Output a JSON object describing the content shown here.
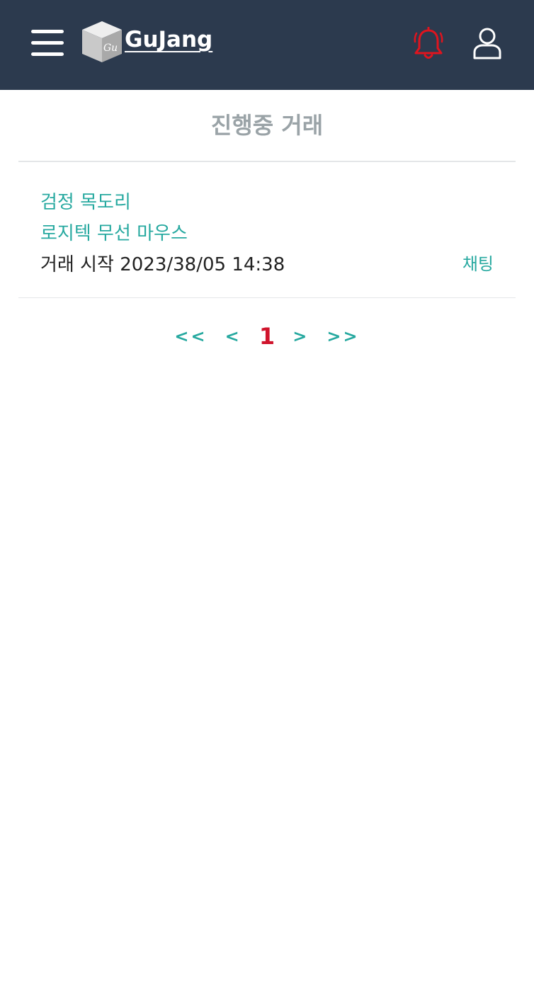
{
  "header": {
    "logo_text": "GuJang",
    "logo_cube_text": "Gu",
    "bell_color": "#e0141e"
  },
  "page": {
    "title": "진행중 거래"
  },
  "trades": [
    {
      "item_names": [
        "검정 목도리",
        "로지텍 무선 마우스"
      ],
      "start_label": "거래 시작 2023/38/05 14:38",
      "chat_label": "채팅"
    }
  ],
  "pagination": {
    "first": "<<",
    "prev": "<",
    "current": "1",
    "next": ">",
    "last": ">>"
  },
  "colors": {
    "header_bg": "#2c3a4e",
    "accent": "#27a9a0",
    "current_page": "#d0142c",
    "title": "#9aa3a7"
  }
}
